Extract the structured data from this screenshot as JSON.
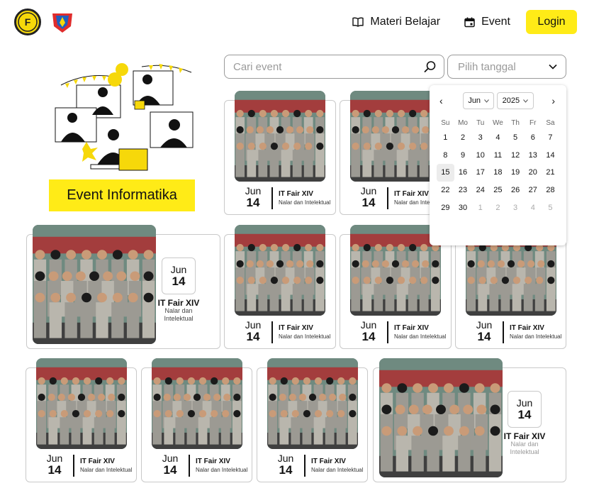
{
  "header": {
    "logos": [
      "school-logo",
      "club-logo"
    ],
    "nav": {
      "materi_label": "Materi Belajar",
      "event_label": "Event",
      "login_label": "Login"
    }
  },
  "hero": {
    "button_label": "Event Informatika"
  },
  "search": {
    "placeholder": "Cari event"
  },
  "date_filter": {
    "placeholder": "Pilih tanggal"
  },
  "calendar": {
    "month": "Jun",
    "year": "2025",
    "weekdays": [
      "Su",
      "Mo",
      "Tu",
      "We",
      "Th",
      "Fr",
      "Sa"
    ],
    "days": [
      {
        "d": "1",
        "cur": true
      },
      {
        "d": "2",
        "cur": true
      },
      {
        "d": "3",
        "cur": true
      },
      {
        "d": "4",
        "cur": true
      },
      {
        "d": "5",
        "cur": true
      },
      {
        "d": "6",
        "cur": true
      },
      {
        "d": "7",
        "cur": true
      },
      {
        "d": "8",
        "cur": true
      },
      {
        "d": "9",
        "cur": true
      },
      {
        "d": "10",
        "cur": true
      },
      {
        "d": "11",
        "cur": true
      },
      {
        "d": "12",
        "cur": true
      },
      {
        "d": "13",
        "cur": true
      },
      {
        "d": "14",
        "cur": true
      },
      {
        "d": "15",
        "cur": true,
        "sel": true
      },
      {
        "d": "16",
        "cur": true
      },
      {
        "d": "17",
        "cur": true
      },
      {
        "d": "18",
        "cur": true
      },
      {
        "d": "19",
        "cur": true
      },
      {
        "d": "20",
        "cur": true
      },
      {
        "d": "21",
        "cur": true
      },
      {
        "d": "22",
        "cur": true
      },
      {
        "d": "23",
        "cur": true
      },
      {
        "d": "24",
        "cur": true
      },
      {
        "d": "25",
        "cur": true
      },
      {
        "d": "26",
        "cur": true
      },
      {
        "d": "27",
        "cur": true
      },
      {
        "d": "28",
        "cur": true
      },
      {
        "d": "29",
        "cur": true
      },
      {
        "d": "30",
        "cur": true
      },
      {
        "d": "1",
        "cur": false
      },
      {
        "d": "2",
        "cur": false
      },
      {
        "d": "3",
        "cur": false
      },
      {
        "d": "4",
        "cur": false
      },
      {
        "d": "5",
        "cur": false
      }
    ]
  },
  "events": [
    {
      "month": "Jun",
      "day": "14",
      "title": "IT Fair XIV",
      "subtitle": "Nalar dan Intelektual"
    }
  ],
  "colors": {
    "accent": "#ffeb17",
    "border": "#c9c9c9"
  }
}
